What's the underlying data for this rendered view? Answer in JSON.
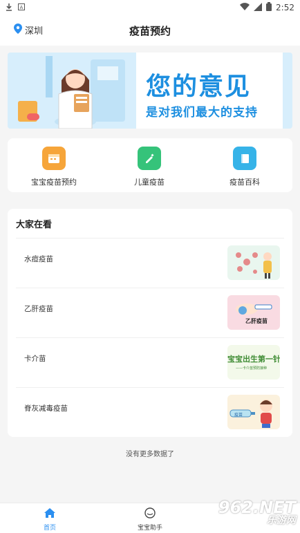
{
  "statusbar": {
    "time": "2:52"
  },
  "header": {
    "location": "深圳",
    "title": "疫苗预约"
  },
  "banner": {
    "line1": "您的意见",
    "line2": "是对我们最大的支持"
  },
  "quick_actions": [
    {
      "label": "宝宝疫苗预约",
      "icon": "calendar-icon",
      "color": "#f6a53a"
    },
    {
      "label": "儿童疫苗",
      "icon": "syringe-icon",
      "color": "#35c37a"
    },
    {
      "label": "疫苗百科",
      "icon": "book-icon",
      "color": "#36b3e8"
    }
  ],
  "section": {
    "title": "大家在看",
    "items": [
      {
        "name": "水痘疫苗"
      },
      {
        "name": "乙肝疫苗",
        "thumb_text": "乙肝疫苗"
      },
      {
        "name": "卡介苗",
        "thumb_text": "宝宝出生第一针",
        "thumb_sub": "——卡介苗预防接种"
      },
      {
        "name": "脊灰减毒疫苗",
        "thumb_text": "疫苗"
      }
    ]
  },
  "footer": {
    "no_more": "没有更多数据了"
  },
  "tabbar": {
    "home": "首页",
    "assistant": "宝宝助手"
  },
  "watermark": {
    "main": "962.NET",
    "sub": "乐游网"
  },
  "colors": {
    "accent": "#1d8fe0"
  }
}
